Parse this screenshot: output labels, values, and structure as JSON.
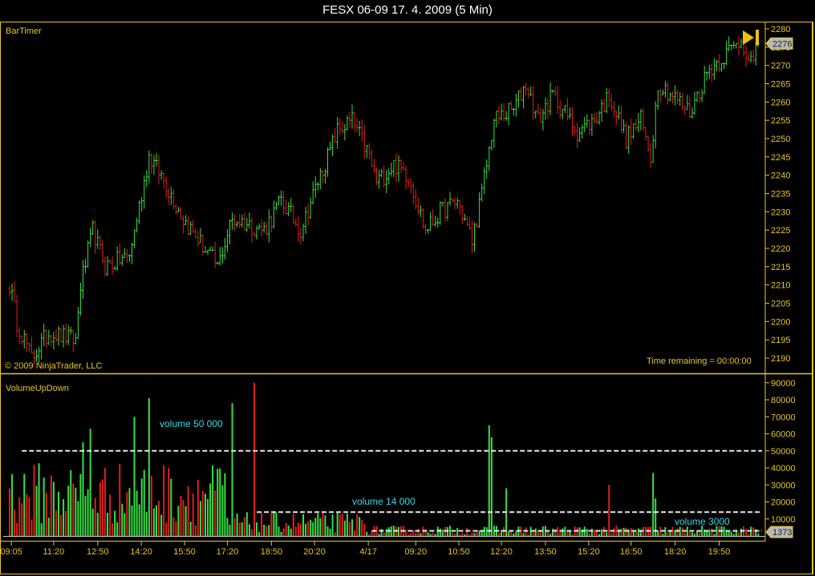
{
  "window": {
    "title": "FESX 06-09  17. 4. 2009 (5 Min)"
  },
  "price_panel": {
    "indicator_label": "BarTimer",
    "copyright": "© 2009 NinjaTrader, LLC",
    "time_remaining": "Time remaining = 00:00:00",
    "last_price_label": "2276"
  },
  "volume_panel": {
    "indicator_label": "VolumeUpDown",
    "last_volume_label": "1373",
    "annotations": [
      "volume 50 000",
      "volume 14 000",
      "volume 3000"
    ]
  },
  "colors": {
    "axis": "#e8c52a",
    "up": "#35e045",
    "down": "#e0201c",
    "annotation": "#38d8e8",
    "line": "#e8e8e8"
  },
  "chart_data": [
    {
      "type": "ohlc",
      "title": "FESX 06-09 (5 Min)",
      "ylim": [
        2187,
        2282
      ],
      "yticks": [
        2190,
        2195,
        2200,
        2205,
        2210,
        2215,
        2220,
        2225,
        2230,
        2235,
        2240,
        2245,
        2250,
        2255,
        2260,
        2265,
        2270,
        2275,
        2280
      ],
      "bar_count": 307,
      "close_keypoints": [
        [
          0,
          2210
        ],
        [
          3,
          2200
        ],
        [
          9,
          2190
        ],
        [
          16,
          2197
        ],
        [
          27,
          2195
        ],
        [
          29,
          2210
        ],
        [
          34,
          2225
        ],
        [
          39,
          2215
        ],
        [
          49,
          2218
        ],
        [
          57,
          2245
        ],
        [
          62,
          2240
        ],
        [
          71,
          2228
        ],
        [
          85,
          2215
        ],
        [
          91,
          2228
        ],
        [
          104,
          2225
        ],
        [
          111,
          2233
        ],
        [
          119,
          2225
        ],
        [
          127,
          2240
        ],
        [
          134,
          2252
        ],
        [
          140,
          2255
        ],
        [
          147,
          2245
        ],
        [
          150,
          2238
        ],
        [
          157,
          2243
        ],
        [
          163,
          2240
        ],
        [
          170,
          2225
        ],
        [
          176,
          2230
        ],
        [
          183,
          2233
        ],
        [
          189,
          2222
        ],
        [
          193,
          2235
        ],
        [
          198,
          2255
        ],
        [
          206,
          2258
        ],
        [
          211,
          2265
        ],
        [
          216,
          2255
        ],
        [
          222,
          2262
        ],
        [
          232,
          2252
        ],
        [
          239,
          2255
        ],
        [
          245,
          2262
        ],
        [
          252,
          2250
        ],
        [
          258,
          2255
        ],
        [
          262,
          2245
        ],
        [
          265,
          2265
        ],
        [
          271,
          2262
        ],
        [
          278,
          2257
        ],
        [
          285,
          2268
        ],
        [
          291,
          2272
        ],
        [
          299,
          2277
        ],
        [
          304,
          2270
        ],
        [
          306,
          2276
        ]
      ],
      "last_price": 2276
    },
    {
      "type": "bar",
      "title": "VolumeUpDown",
      "ylim": [
        0,
        92000
      ],
      "yticks": [
        10000,
        20000,
        30000,
        40000,
        50000,
        60000,
        70000,
        80000,
        90000
      ],
      "volume_levels": [
        [
          0,
          89,
          25000
        ],
        [
          89,
          147,
          8000
        ],
        [
          147,
          307,
          3500
        ]
      ],
      "spikes": [
        [
          30,
          55000
        ],
        [
          33,
          63000
        ],
        [
          51,
          70000
        ],
        [
          57,
          81000
        ],
        [
          91,
          78000
        ],
        [
          100,
          90000
        ],
        [
          196,
          65000
        ],
        [
          197,
          58000
        ],
        [
          203,
          28000
        ],
        [
          245,
          30000
        ],
        [
          263,
          37000
        ],
        [
          264,
          22000
        ]
      ],
      "reference_lines": [
        {
          "value": 50000,
          "from_bar": 5,
          "label": "volume 50 000"
        },
        {
          "value": 14000,
          "from_bar": 101,
          "label": "volume 14 000"
        },
        {
          "value": 3000,
          "from_bar": 148,
          "label": "volume 3000"
        }
      ],
      "last_volume": 1373
    }
  ],
  "x_axis": {
    "ticks": [
      [
        0.7,
        "09:05"
      ],
      [
        18,
        "11:20"
      ],
      [
        36,
        "12:50"
      ],
      [
        53.8,
        "14:20"
      ],
      [
        71.5,
        "15:50"
      ],
      [
        89,
        "17:20"
      ],
      [
        107,
        "18:50"
      ],
      [
        124.6,
        "20:20"
      ],
      [
        146.6,
        "4/17"
      ],
      [
        166,
        "09:20"
      ],
      [
        183.6,
        "10:50"
      ],
      [
        201,
        "12:20"
      ],
      [
        219,
        "13:50"
      ],
      [
        236.7,
        "15:20"
      ],
      [
        254,
        "16:50"
      ],
      [
        272,
        "18:20"
      ],
      [
        290,
        "19:50"
      ]
    ]
  }
}
